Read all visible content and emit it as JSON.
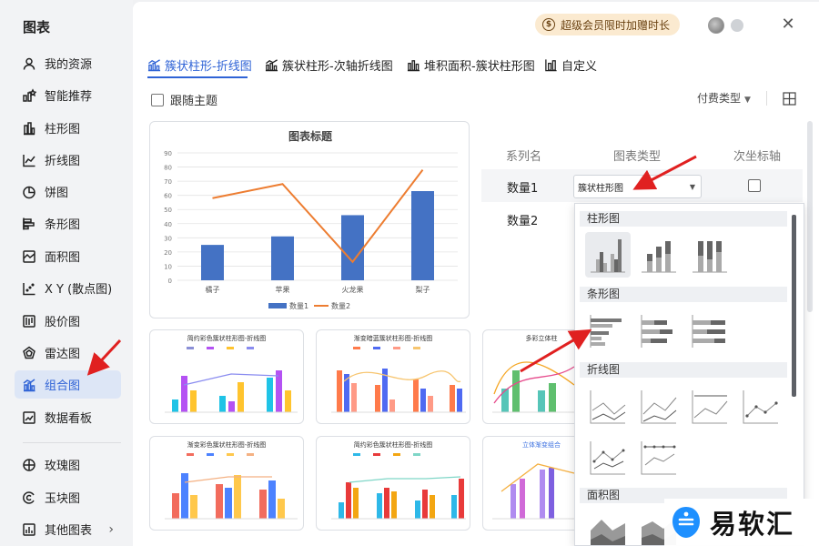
{
  "sidebar": {
    "title": "图表",
    "items": [
      {
        "label": "我的资源",
        "icon": "user-icon"
      },
      {
        "label": "智能推荐",
        "icon": "recommend-icon"
      },
      {
        "label": "柱形图",
        "icon": "bar-chart-icon"
      },
      {
        "label": "折线图",
        "icon": "line-chart-icon"
      },
      {
        "label": "饼图",
        "icon": "pie-chart-icon"
      },
      {
        "label": "条形图",
        "icon": "horizontal-bar-icon"
      },
      {
        "label": "面积图",
        "icon": "area-chart-icon"
      },
      {
        "label": "X Y (散点图)",
        "icon": "scatter-icon"
      },
      {
        "label": "股价图",
        "icon": "stock-chart-icon"
      },
      {
        "label": "雷达图",
        "icon": "radar-chart-icon"
      },
      {
        "label": "组合图",
        "icon": "combo-chart-icon",
        "active": true
      },
      {
        "label": "数据看板",
        "icon": "dashboard-icon"
      },
      {
        "label": "玫瑰图",
        "icon": "rose-chart-icon"
      },
      {
        "label": "玉块图",
        "icon": "jade-chart-icon"
      },
      {
        "label": "其他图表",
        "icon": "more-charts-icon"
      }
    ]
  },
  "header": {
    "promo": "超级会员限时加赠时长"
  },
  "tabs": [
    {
      "label": "簇状柱形-折线图",
      "active": true
    },
    {
      "label": "簇状柱形-次轴折线图"
    },
    {
      "label": "堆积面积-簇状柱形图"
    },
    {
      "label": "自定义"
    }
  ],
  "toolbar": {
    "follow_theme": "跟随主题",
    "pay_type": "付费类型"
  },
  "preview": {
    "title": "图表标题",
    "chart_data": {
      "type": "bar",
      "combo": "bar+line",
      "title": "图表标题",
      "categories": [
        "橘子",
        "苹果",
        "火龙果",
        "梨子"
      ],
      "ylim": [
        0,
        90
      ],
      "yticks": [
        0,
        10,
        20,
        30,
        40,
        50,
        60,
        70,
        80,
        90
      ],
      "series": [
        {
          "name": "数量1",
          "type": "bar",
          "color": "#4472c4",
          "values": [
            25,
            31,
            46,
            63
          ]
        },
        {
          "name": "数量2",
          "type": "line",
          "color": "#ed7d31",
          "values": [
            58,
            68,
            13,
            78
          ]
        }
      ],
      "legend": "bottom",
      "grid": true
    }
  },
  "thumbnails": [
    {
      "title": "简约彩色簇状柱形图-折线图"
    },
    {
      "title": "渐变暗蓝簇状柱形图-折线图"
    },
    {
      "title": "多彩立体柱"
    },
    {
      "title": "渐变彩色簇状柱形图-折线图"
    },
    {
      "title": "简约彩色簇状柱形图-折线图"
    },
    {
      "title": "立体渐变组合"
    }
  ],
  "series_panel": {
    "headers": [
      "系列名",
      "图表类型",
      "次坐标轴"
    ],
    "rows": [
      {
        "name": "数量1",
        "type": "簇状柱形图"
      },
      {
        "name": "数量2",
        "type": ""
      }
    ]
  },
  "dropdown": {
    "sections": [
      "柱形图",
      "条形图",
      "折线图",
      "面积图"
    ]
  },
  "watermark": "易软汇",
  "colors": {
    "accent": "#2f63d6",
    "bar": "#4472c4",
    "line": "#ed7d31",
    "arrow": "#e02020"
  }
}
